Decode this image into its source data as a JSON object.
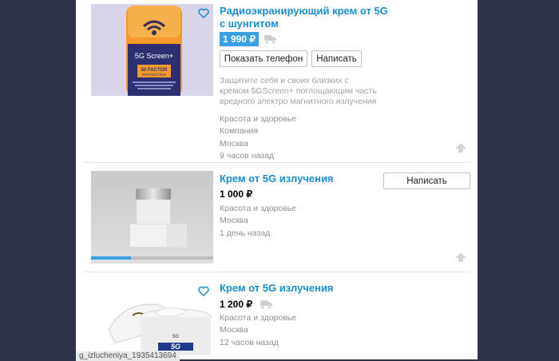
{
  "listings": [
    {
      "title_line1": "Радиоэкранирующий крем от 5G",
      "title_line2": "с шунгитом",
      "price": "1 990 ₽",
      "btn_phone": "Показать телефон",
      "btn_write": "Написать",
      "description_lines": [
        "Защитите себя и своих близких с",
        "кремом 5GScreen+ поглощающим часть",
        "вредного электро магнитного излучения"
      ],
      "product_label": "5G Screen+",
      "product_badge_line1": "50 FACTOR",
      "product_badge_line2": "PROTECTION",
      "category": "Красота и здоровье",
      "seller_type": "Компания",
      "city": "Москва",
      "posted": "9 часов назад"
    },
    {
      "title": "Крем от 5G излучения",
      "price": "1 000 ₽",
      "btn_write": "Написать",
      "category": "Красота и здоровье",
      "city": "Москва",
      "posted": "1 день назад"
    },
    {
      "title": "Крем от 5G излучения",
      "price": "1 200 ₽",
      "product_label": "5G",
      "category": "Красота и здоровье",
      "city": "Москва",
      "posted": "12 часов назад"
    }
  ],
  "status_bar_url": "g_izlucheniya_1935413694",
  "colors": {
    "link": "#1a8dd1",
    "price_highlight": "#3aa0e6",
    "backdrop": "#2f3348"
  }
}
